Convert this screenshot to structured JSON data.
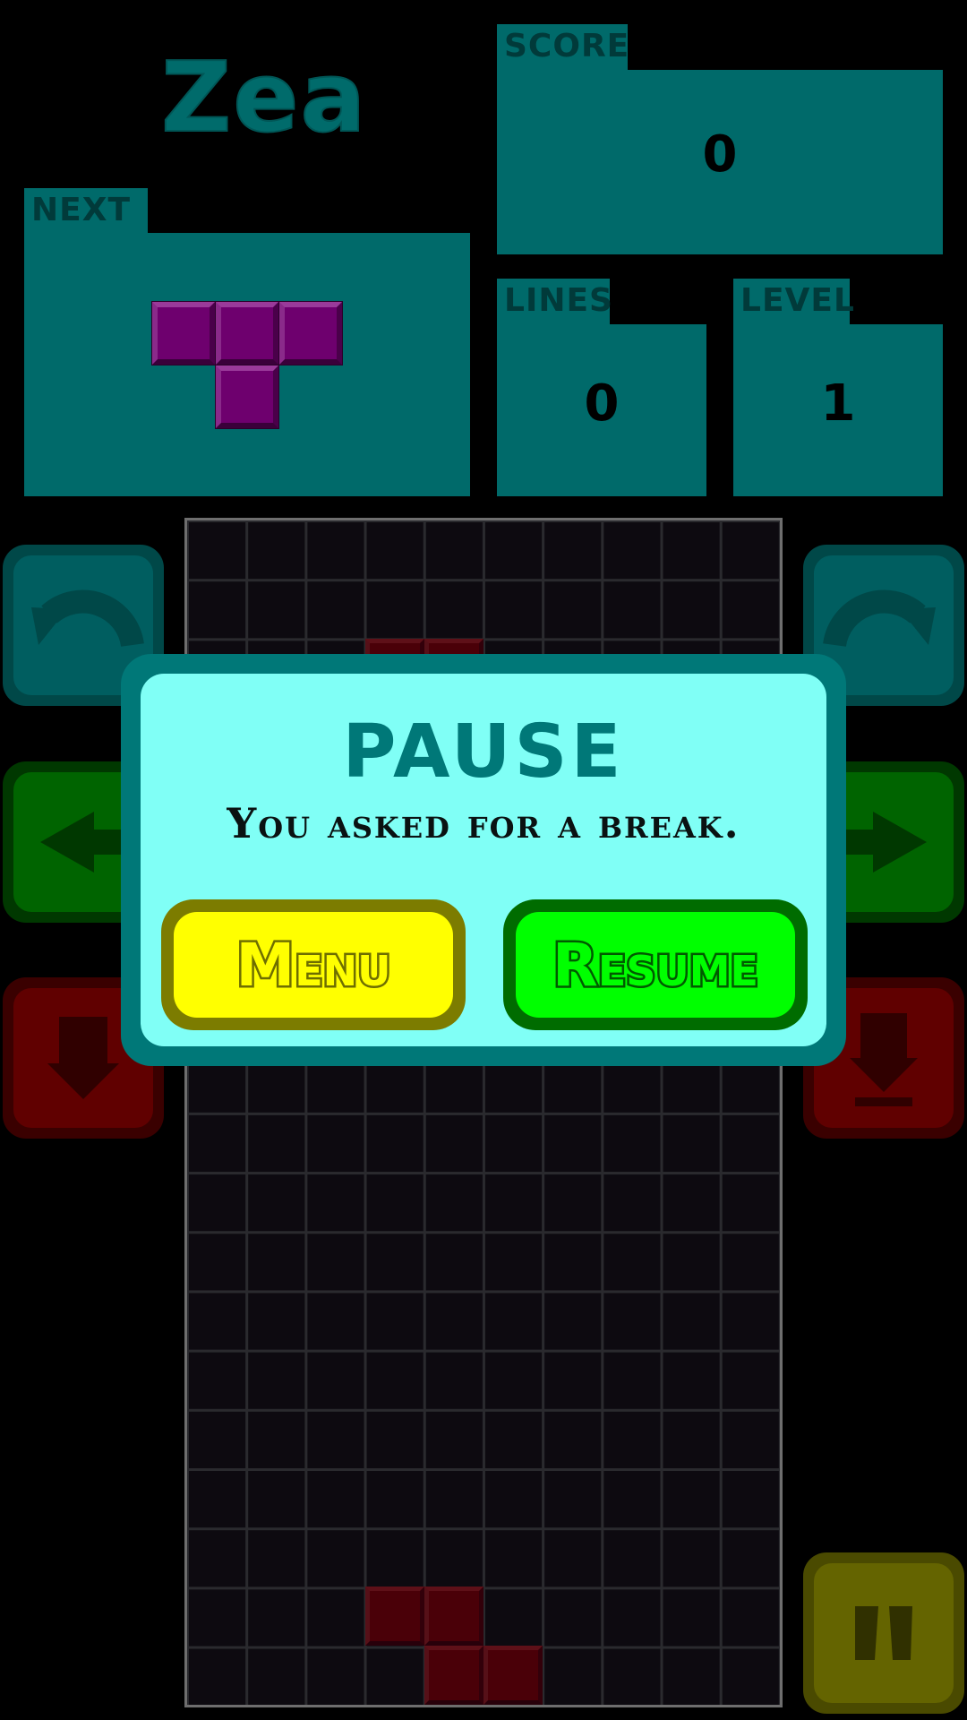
{
  "game": {
    "logo_text": "Zea"
  },
  "stats": {
    "score_label": "SCORE",
    "score_value": "0",
    "next_label": "NEXT",
    "lines_label": "LINES",
    "lines_value": "0",
    "level_label": "LEVEL",
    "level_value": "1"
  },
  "colors": {
    "panel": "#006a6a",
    "next_piece": "#6e006e",
    "board_pieces": "#4a0008",
    "dialog_bg": "#80fff6",
    "dialog_border": "#007878",
    "menu_button": "#ffff00",
    "resume_button": "#00ff00"
  },
  "controls": {
    "rotate_left_icon": "rotate-left-icon",
    "rotate_right_icon": "rotate-right-icon",
    "move_left_icon": "arrow-left-icon",
    "move_right_icon": "arrow-right-icon",
    "soft_drop_icon": "arrow-down-icon",
    "hard_drop_icon": "hard-drop-icon",
    "pause_icon": "pause-icon"
  },
  "dialog": {
    "title": "PAUSE",
    "message": "You asked for a break.",
    "menu_label": "Menu",
    "resume_label": "Resume"
  }
}
